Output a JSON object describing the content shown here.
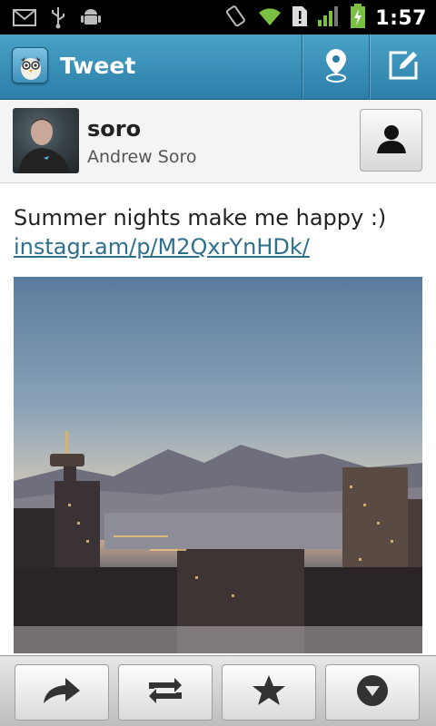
{
  "status_bar": {
    "time": "1:57",
    "icons": [
      "gmail-icon",
      "usb-icon",
      "android-debug-icon",
      "vibrate-icon",
      "wifi-icon",
      "no-sim-icon",
      "signal-icon",
      "battery-charging-icon"
    ]
  },
  "action_bar": {
    "title": "Tweet",
    "icons": [
      "hootsuite-owl-icon",
      "location-pin-icon",
      "compose-icon"
    ]
  },
  "profile": {
    "username": "soro",
    "real_name": "Andrew Soro"
  },
  "tweet": {
    "text": "Summer nights make me happy :)",
    "link": "instagr.am/p/M2QxrYnHDk/"
  },
  "toolbar": {
    "icons": [
      "reply-icon",
      "retweet-icon",
      "favorite-star-icon",
      "more-dropdown-icon"
    ]
  },
  "colors": {
    "action_bar": "#3a90b8",
    "link": "#2f6f8e"
  }
}
